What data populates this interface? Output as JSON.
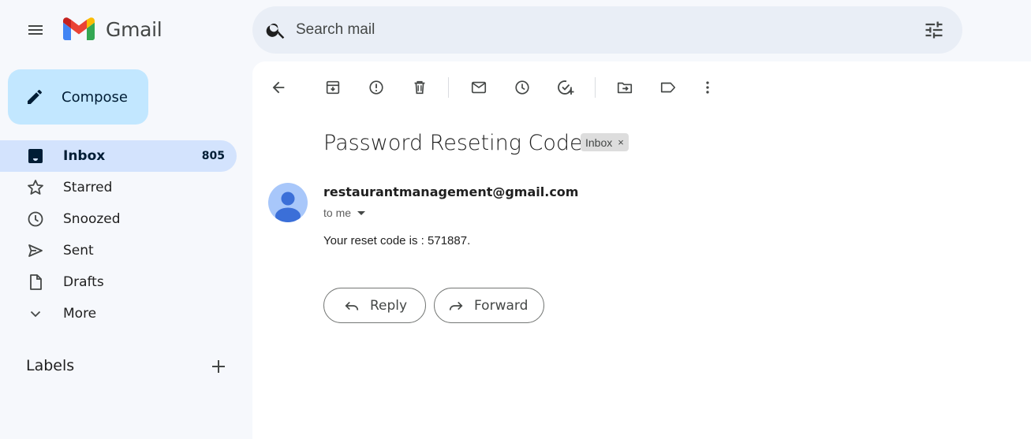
{
  "app": {
    "name": "Gmail"
  },
  "search": {
    "placeholder": "Search mail",
    "value": ""
  },
  "compose": {
    "label": "Compose"
  },
  "nav": {
    "items": [
      {
        "label": "Inbox",
        "count": "805"
      },
      {
        "label": "Starred"
      },
      {
        "label": "Snoozed"
      },
      {
        "label": "Sent"
      },
      {
        "label": "Drafts"
      },
      {
        "label": "More"
      }
    ]
  },
  "labels": {
    "title": "Labels"
  },
  "email": {
    "subject": "Password Reseting Code.",
    "badge": "Inbox",
    "badge_close": "×",
    "sender": "restaurantmanagement@gmail.com",
    "to": "to me",
    "body": "Your reset code is : 571887."
  },
  "actions": {
    "reply": "Reply",
    "forward": "Forward"
  },
  "colors": {
    "background": "#f6f8fc",
    "compose": "#c2e7ff",
    "active_nav": "#d3e3fd",
    "search_bg": "#e9eef6",
    "avatar": "#a8c7fa",
    "avatar_figure": "#3b6fd8"
  },
  "icons": {
    "toolbar": [
      "back-arrow-icon",
      "archive-icon",
      "report-spam-icon",
      "delete-icon",
      "mark-unread-icon",
      "snooze-icon",
      "add-to-tasks-icon",
      "move-to-icon",
      "label-icon",
      "more-vert-icon"
    ]
  }
}
